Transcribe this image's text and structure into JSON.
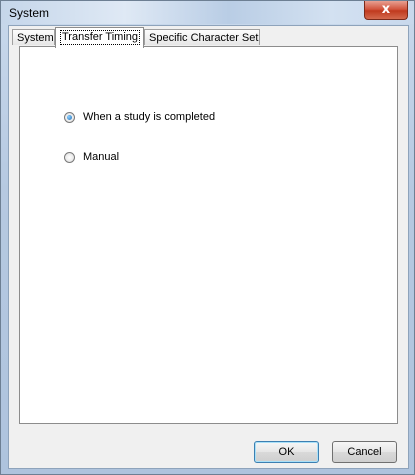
{
  "window": {
    "title": "System",
    "close_glyph": "x"
  },
  "tabs": [
    {
      "label": "System",
      "active": false
    },
    {
      "label": "Transfer Timing",
      "active": true
    },
    {
      "label": "Specific Character Set",
      "active": false
    }
  ],
  "transfer_timing": {
    "options": [
      {
        "label": "When a study is completed",
        "checked": true
      },
      {
        "label": "Manual",
        "checked": false
      }
    ]
  },
  "buttons": {
    "ok": "OK",
    "cancel": "Cancel"
  },
  "colors": {
    "accent": "#1f6fb8",
    "close": "#c03a1e",
    "frame": "#b6c9e1"
  }
}
